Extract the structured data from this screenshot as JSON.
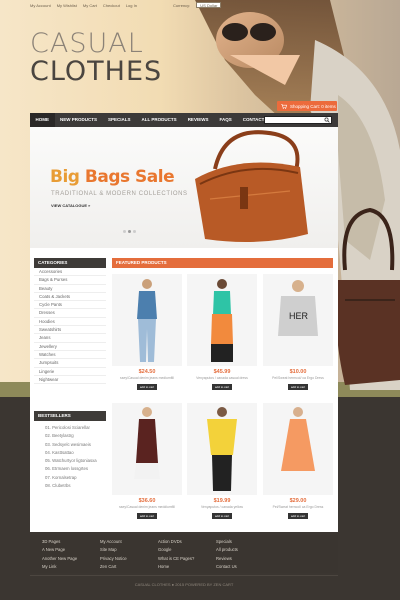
{
  "topbar": {
    "links": [
      "My Account",
      "My Wishlist",
      "My Cart",
      "Checkout",
      "Log In"
    ],
    "currency_label": "Currency:",
    "currency_value": "US Dollar"
  },
  "logo": {
    "line1": "CASUAL",
    "line2": "CLOTHES"
  },
  "cart": {
    "label": "Shopping Cart: 0 items"
  },
  "nav": {
    "items": [
      "HOME",
      "NEW PRODUCTS",
      "SPECIALS",
      "ALL PRODUCTS",
      "REVIEWS",
      "FAQs",
      "CONTACT US"
    ]
  },
  "banner": {
    "title_part1": "Big",
    "title_part2": " Bags Sale",
    "subtitle": "TRADITIONAL & MODERN COLLECTIONS",
    "link": "VIEW CATALOGUE »"
  },
  "categories": {
    "heading": "CATEGORIES",
    "items": [
      "Accessories",
      "Bags & Purses",
      "Beauty",
      "Coats & Jackets",
      "Cycle Pants",
      "Dresses",
      "Hoodies",
      "Sweatshirts",
      "Jeans",
      "Jewellery",
      "Watches",
      "Jumpsuits",
      "Lingerie",
      "Nightwear"
    ]
  },
  "bestsellers": {
    "heading": "BESTSELLERS",
    "items": [
      "01. Pericolosi Sciarellar",
      "02. Beetylastrg",
      "03. Sedsyelc wesimaeis",
      "04. Kasttsattao",
      "05. Watchurtyor ligtoniasxa",
      "06. Etrmaem lossgrtes",
      "07. Kornalsetrap",
      "08. Clubetrbs"
    ]
  },
  "featured": {
    "heading": "FEATURED PRODUCTS",
    "products": [
      {
        "price": "$24.50",
        "name": "ssey/Casual denim jeans mediumfill",
        "button": "add to cart"
      },
      {
        "price": "$45.99",
        "name": "Venyaputos / canada casual dress",
        "button": "add to cart"
      },
      {
        "price": "$10.00",
        "name": "Pel/Sweat hermcol/ ca Ergo Dress",
        "button": "add to cart"
      },
      {
        "price": "$36.60",
        "name": "ssey/Casual denim jeans meddiumfill",
        "button": "add to cart"
      },
      {
        "price": "$19.99",
        "name": "Venyaputos / canada yellow",
        "button": "add to cart"
      },
      {
        "price": "$29.00",
        "name": "Pel/Sweat herncol/ ca Ergo Dress",
        "button": "add to cart"
      }
    ]
  },
  "footer": {
    "col1": [
      "3D Pages",
      "A New Page",
      "Another New Page",
      "My Link"
    ],
    "col2": [
      "My Account",
      "Site Map",
      "Privacy Notice",
      "Zen Cart"
    ],
    "col3": [
      "Action DVDs",
      "Google",
      "What is CE Pages?",
      "Home"
    ],
    "col4": [
      "Specials",
      "All products",
      "Reviews",
      "Contact Us"
    ],
    "copyright": "CASUAL CLOTHES ● 2015 POWERED BY ZEN CART"
  },
  "colors": {
    "accent": "#e46d3c",
    "nav": "#3c3a39",
    "footer": "#3a3530"
  }
}
